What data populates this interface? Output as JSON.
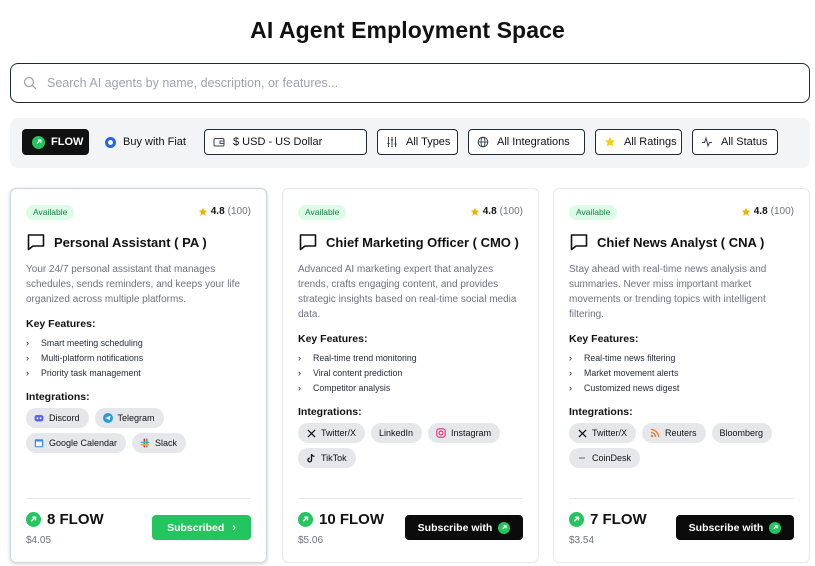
{
  "page_title": "AI Agent Employment Space",
  "search": {
    "placeholder": "Search AI agents by name, description, or features..."
  },
  "filters": {
    "flow_label": "FLOW",
    "fiat_label": "Buy with Fiat",
    "currency": "$ USD - US Dollar",
    "types": "All Types",
    "integrations": "All Integrations",
    "ratings": "All Ratings",
    "status": "All Status"
  },
  "colors": {
    "accent_green": "#22c55e",
    "badge_bg": "#dcfce7",
    "star": "#facc15",
    "fiat_blue": "#2563eb"
  },
  "cards": [
    {
      "status": "Available",
      "rating": "4.8",
      "rating_count": "(100)",
      "title": "Personal Assistant ( PA )",
      "description": "Your 24/7 personal assistant that manages schedules, sends reminders, and keeps your life organized across multiple platforms.",
      "features_heading": "Key Features:",
      "features": [
        "Smart meeting scheduling",
        "Multi-platform notifications",
        "Priority task management"
      ],
      "integrations_heading": "Integrations:",
      "integrations": [
        {
          "name": "Discord",
          "icon": "discord-icon"
        },
        {
          "name": "Telegram",
          "icon": "telegram-icon"
        },
        {
          "name": "Google Calendar",
          "icon": "calendar-icon"
        },
        {
          "name": "Slack",
          "icon": "slack-icon"
        }
      ],
      "price": "8 FLOW",
      "fiat_price": "$4.05",
      "cta": "Subscribed"
    },
    {
      "status": "Available",
      "rating": "4.8",
      "rating_count": "(100)",
      "title": "Chief Marketing Officer ( CMO )",
      "description": "Advanced AI marketing expert that analyzes trends, crafts engaging content, and provides strategic insights based on real-time social media data.",
      "features_heading": "Key Features:",
      "features": [
        "Real-time trend monitoring",
        "Viral content prediction",
        "Competitor analysis"
      ],
      "integrations_heading": "Integrations:",
      "integrations": [
        {
          "name": "Twitter/X",
          "icon": "x-icon"
        },
        {
          "name": "LinkedIn",
          "icon": ""
        },
        {
          "name": "Instagram",
          "icon": "instagram-icon"
        },
        {
          "name": "TikTok",
          "icon": "tiktok-icon"
        }
      ],
      "price": "10 FLOW",
      "fiat_price": "$5.06",
      "cta": "Subscribe with"
    },
    {
      "status": "Available",
      "rating": "4.8",
      "rating_count": "(100)",
      "title": "Chief News Analyst ( CNA )",
      "description": "Stay ahead with real-time news analysis and summaries. Never miss important market movements or trending topics with intelligent filtering.",
      "features_heading": "Key Features:",
      "features": [
        "Real-time news filtering",
        "Market movement alerts",
        "Customized news digest"
      ],
      "integrations_heading": "Integrations:",
      "integrations": [
        {
          "name": "Twitter/X",
          "icon": "x-icon"
        },
        {
          "name": "Reuters",
          "icon": "rss-icon"
        },
        {
          "name": "Bloomberg",
          "icon": ""
        },
        {
          "name": "CoinDesk",
          "icon": "dash-icon"
        }
      ],
      "price": "7 FLOW",
      "fiat_price": "$3.54",
      "cta": "Subscribe with"
    }
  ]
}
